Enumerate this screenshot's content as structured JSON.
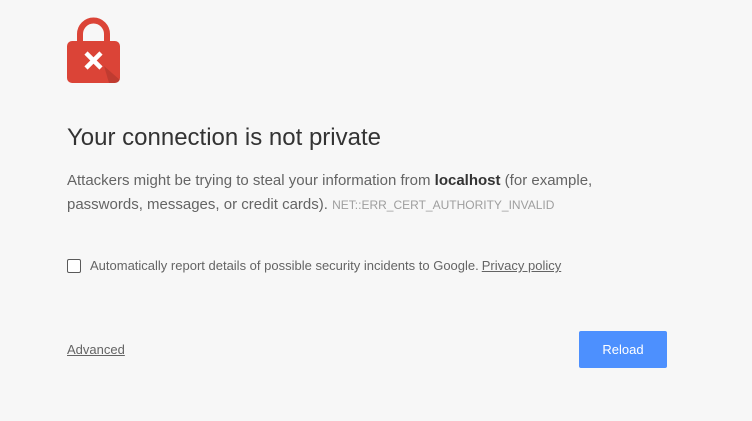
{
  "icon": {
    "name": "lock-error-icon",
    "color": "#db4437",
    "glyph": "×"
  },
  "heading": "Your connection is not private",
  "message": {
    "prefix": "Attackers might be trying to steal your information from ",
    "host": "localhost",
    "suffix": " (for example, passwords, messages, or credit cards).",
    "error_code": "NET::ERR_CERT_AUTHORITY_INVALID"
  },
  "report": {
    "checked": false,
    "text": "Automatically report details of possible security incidents to Google.",
    "link": "Privacy policy"
  },
  "actions": {
    "advanced": "Advanced",
    "reload": "Reload",
    "reload_color": "#4d90fe"
  }
}
